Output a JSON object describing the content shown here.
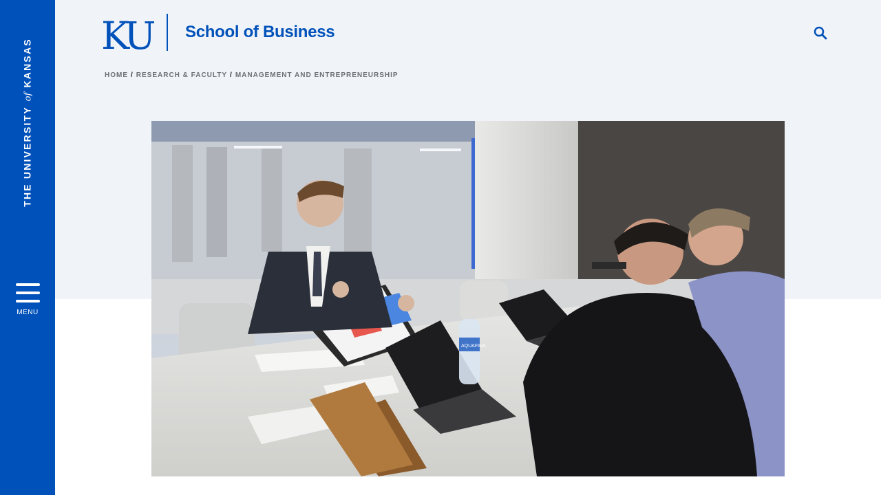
{
  "sidebar": {
    "university_text_before": "THE UNIVERSITY",
    "university_text_of": "of",
    "university_text_after": "KANSAS",
    "menu_label": "MENU"
  },
  "header": {
    "logo_text": "KU",
    "site_title": "School of Business",
    "search_icon": "search-icon"
  },
  "breadcrumb": {
    "items": [
      "HOME",
      "RESEARCH & FACULTY",
      "MANAGEMENT AND ENTREPRENEURSHIP"
    ],
    "separator": "/"
  },
  "hero_image": {
    "bottle_label": "AQUAFINA"
  },
  "colors": {
    "brand_blue": "#0051ba",
    "band_background": "#f0f4f8"
  }
}
